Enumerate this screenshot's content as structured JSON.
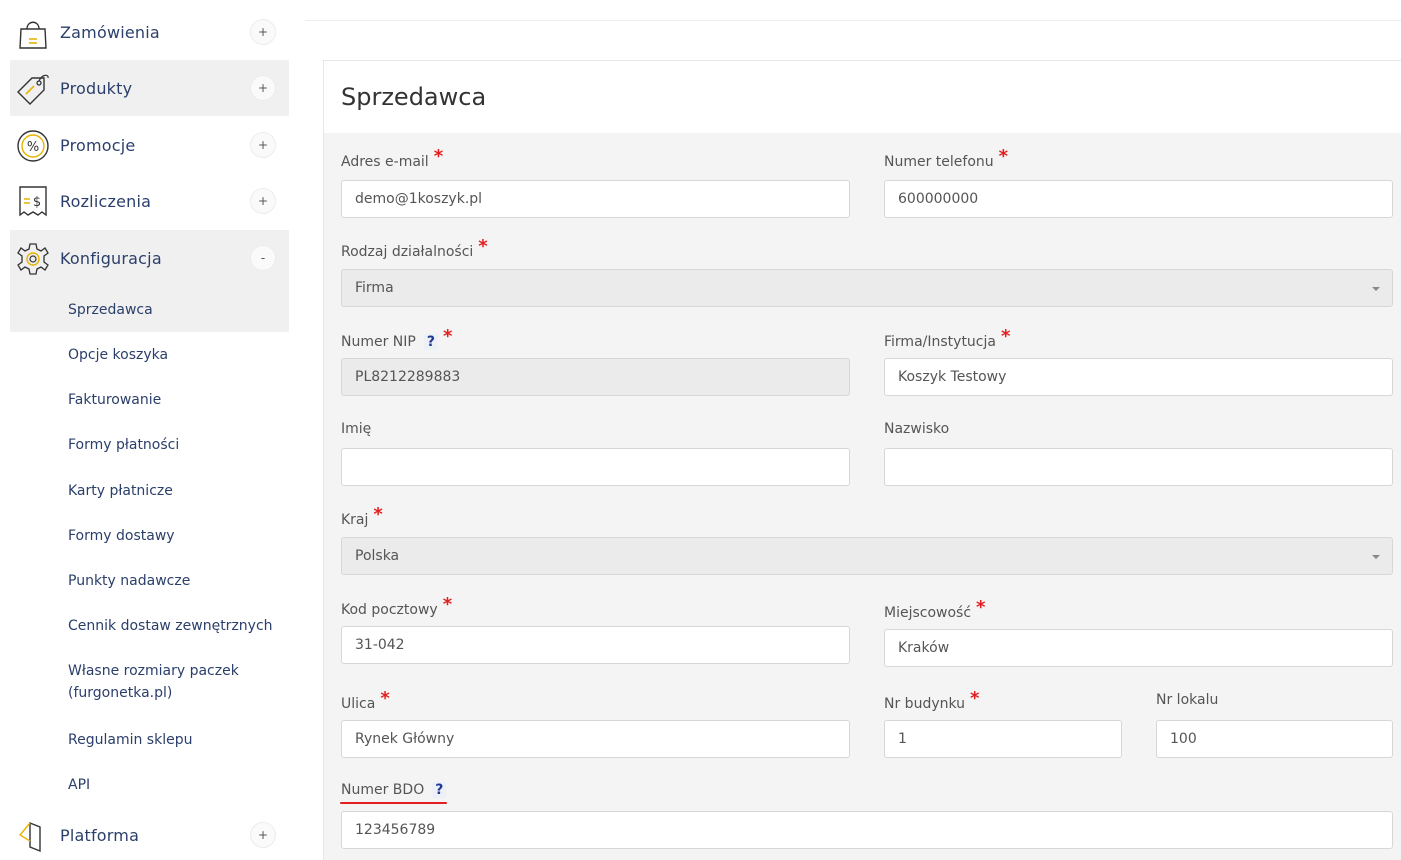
{
  "sidebar": {
    "items": [
      {
        "label": "Zamówienia",
        "toggle": "+",
        "icon": "shopping-bag-icon"
      },
      {
        "label": "Produkty",
        "toggle": "+",
        "icon": "price-tag-icon"
      },
      {
        "label": "Promocje",
        "toggle": "+",
        "icon": "percent-icon"
      },
      {
        "label": "Rozliczenia",
        "toggle": "+",
        "icon": "receipt-icon"
      },
      {
        "label": "Konfiguracja",
        "toggle": "-",
        "icon": "gear-icon"
      },
      {
        "label": "Platforma",
        "toggle": "+",
        "icon": "platform-icon"
      }
    ],
    "subitems": [
      "Sprzedawca",
      "Opcje koszyka",
      "Fakturowanie",
      "Formy płatności",
      "Karty płatnicze",
      "Formy dostawy",
      "Punkty nadawcze",
      "Cennik dostaw zewnętrznych",
      "Własne rozmiary paczek (furgonetka.pl)",
      "Regulamin sklepu",
      "API"
    ],
    "subitems_wrapped": {
      "line1": "Własne rozmiary paczek",
      "line2": "(furgonetka.pl)"
    }
  },
  "page": {
    "title": "Sprzedawca"
  },
  "form": {
    "email": {
      "label": "Adres e-mail",
      "value": "demo@1koszyk.pl"
    },
    "phone": {
      "label": "Numer telefonu",
      "value": "600000000"
    },
    "business_type": {
      "label": "Rodzaj działalności",
      "value": "Firma"
    },
    "nip": {
      "label": "Numer NIP",
      "help": "?",
      "value": "PL8212289883"
    },
    "company": {
      "label": "Firma/Instytucja",
      "value": "Koszyk Testowy"
    },
    "first_name": {
      "label": "Imię",
      "value": ""
    },
    "last_name": {
      "label": "Nazwisko",
      "value": ""
    },
    "country": {
      "label": "Kraj",
      "value": "Polska"
    },
    "postal_code": {
      "label": "Kod pocztowy",
      "value": "31-042"
    },
    "city": {
      "label": "Miejscowość",
      "value": "Kraków"
    },
    "street": {
      "label": "Ulica",
      "value": "Rynek Główny"
    },
    "building": {
      "label": "Nr budynku",
      "value": "1"
    },
    "apartment": {
      "label": "Nr lokalu",
      "value": "100"
    },
    "bdo": {
      "label": "Numer BDO",
      "help": "?",
      "value": "123456789"
    },
    "required_mark": "*"
  },
  "colors": {
    "nav_text": "#2b3f6b",
    "required": "#e41e1e",
    "help": "#1f3a93"
  }
}
